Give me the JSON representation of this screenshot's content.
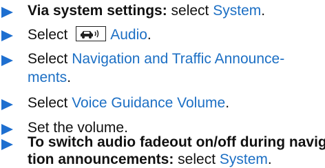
{
  "steps": [
    {
      "bold": "Via system settings:",
      "plain": " select ",
      "blue": "System",
      "tail": "."
    },
    {
      "plain": "Select ",
      "blue": "Audio",
      "tail": "."
    },
    {
      "plain": "Select ",
      "blue_line1": "Navigation and Traffic Announce-",
      "blue_line2": "ments",
      "tail": "."
    },
    {
      "plain": "Select ",
      "blue": "Voice Guidance Volume",
      "tail": "."
    },
    {
      "plain": "Set the volume."
    },
    {
      "bold_line1": "To switch audio fadeout on/off during naviga-",
      "bold_line2": "tion announcements:",
      "plain": " select ",
      "blue": "System",
      "tail": "."
    }
  ],
  "icons": {
    "audio": "car-sound-icon"
  },
  "colors": {
    "accent": "#1e6fd0",
    "link_blue": "#1c6fc4",
    "text": "#111111"
  }
}
